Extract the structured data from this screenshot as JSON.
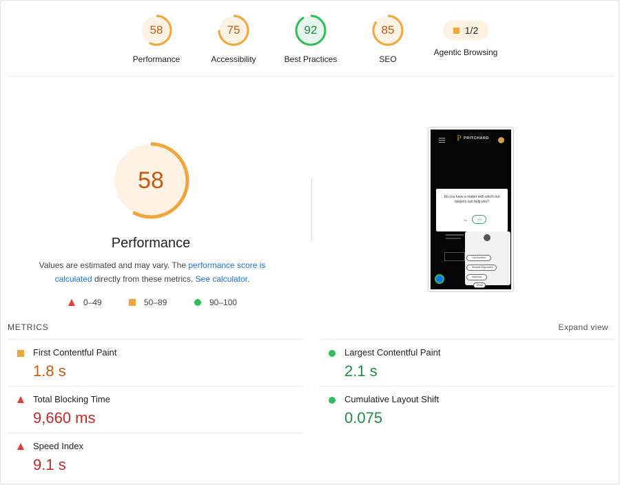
{
  "categories": [
    {
      "score": "58",
      "label": "Performance",
      "value": 58,
      "color": "#f0a63a",
      "bg": "#fdf2e3",
      "text": "#c65a12"
    },
    {
      "score": "75",
      "label": "Accessibility",
      "value": 75,
      "color": "#f0a63a",
      "bg": "#fdf2e3",
      "text": "#c65a12"
    },
    {
      "score": "92",
      "label": "Best Practices",
      "value": 92,
      "color": "#2fbe5a",
      "bg": "#e7f6ec",
      "text": "#1e8e3e"
    },
    {
      "score": "85",
      "label": "SEO",
      "value": 85,
      "color": "#f0a63a",
      "bg": "#fdf2e3",
      "text": "#c65a12"
    },
    {
      "score": "1/2",
      "label": "Agentic Browsing",
      "icon": "orange-square-icon"
    }
  ],
  "performance": {
    "score": "58",
    "value": 58,
    "title": "Performance",
    "desc_part1": "Values are estimated and may vary. The ",
    "desc_link1": "performance score is calculated",
    "desc_part2": " directly from these metrics. ",
    "desc_link2": "See calculator",
    "desc_part3": "."
  },
  "legend": {
    "fail": "0–49",
    "average": "50–89",
    "pass": "90–100"
  },
  "screenshot": {
    "logo_mark": "P",
    "logo_text": "PRITCHARD",
    "question": "Do you have a matter with which our lawyers can help you?",
    "no": "No",
    "yes": "Yes",
    "options": [
      "Car Accident",
      "Medical Malpractice",
      "Asbestos"
    ],
    "scroll": "Scroll"
  },
  "metrics": {
    "header": "METRICS",
    "expand": "Expand view",
    "items": [
      {
        "label": "First Contentful Paint",
        "value": "1.8 s",
        "status": "average"
      },
      {
        "label": "Largest Contentful Paint",
        "value": "2.1 s",
        "status": "pass"
      },
      {
        "label": "Total Blocking Time",
        "value": "9,660 ms",
        "status": "fail"
      },
      {
        "label": "Cumulative Layout Shift",
        "value": "0.075",
        "status": "pass"
      },
      {
        "label": "Speed Index",
        "value": "9.1 s",
        "status": "fail"
      }
    ]
  },
  "colors": {
    "orange": "#f0a63a",
    "green": "#2fbe5a",
    "red": "#e53935",
    "link": "#1a73e8"
  }
}
